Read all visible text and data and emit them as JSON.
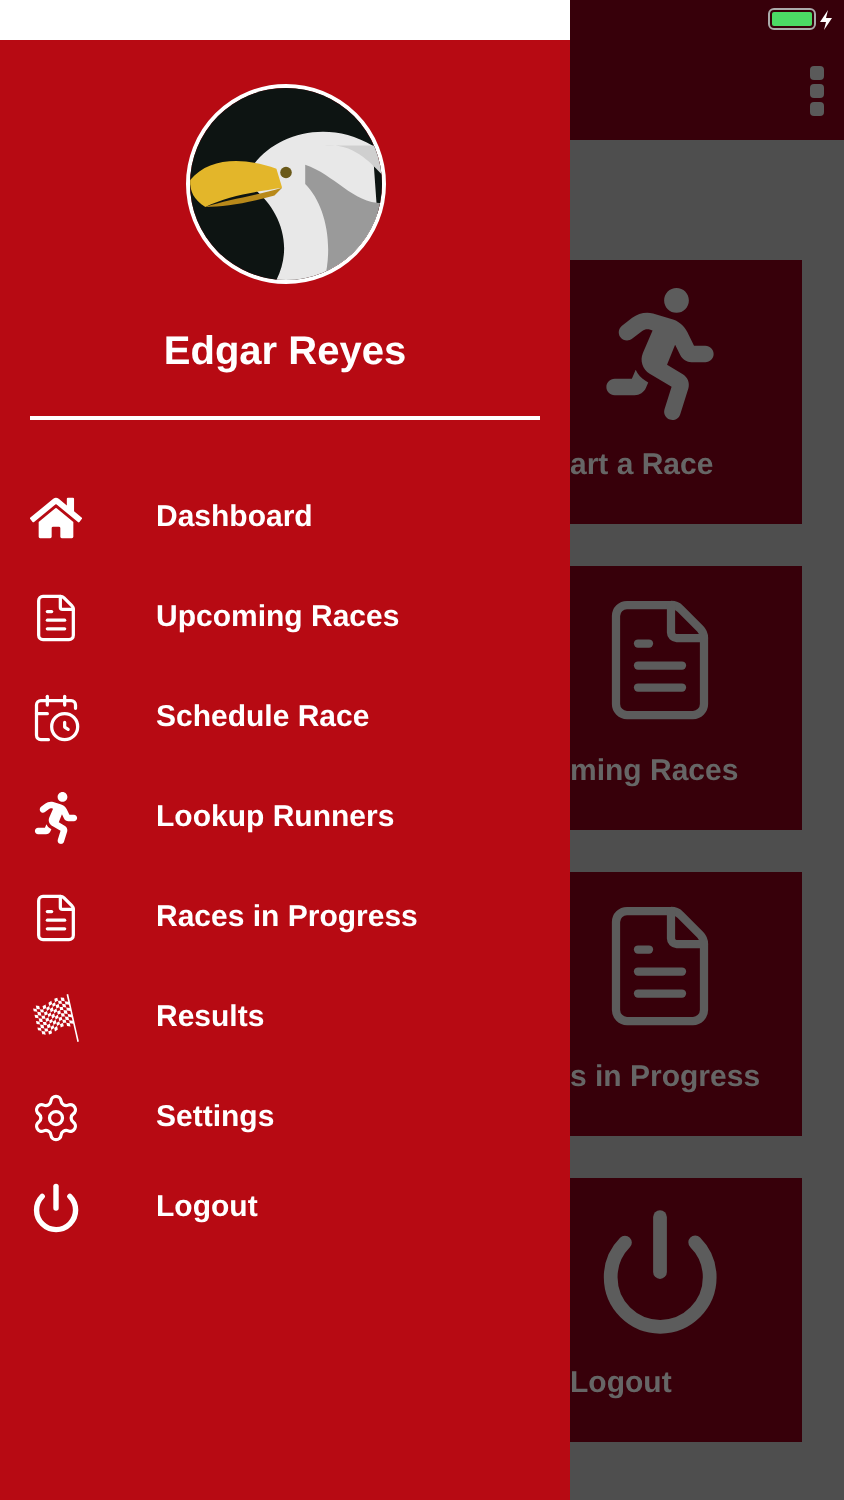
{
  "drawer": {
    "user_name": "Edgar Reyes",
    "menu": [
      {
        "label": "Dashboard",
        "kind": "home"
      },
      {
        "label": "Upcoming Races",
        "kind": "document"
      },
      {
        "label": "Schedule Race",
        "kind": "calendar"
      },
      {
        "label": "Lookup Runners",
        "kind": "runner"
      },
      {
        "label": "Races in Progress",
        "kind": "document"
      },
      {
        "label": "Results",
        "kind": "flag"
      },
      {
        "label": "Settings",
        "kind": "gear"
      },
      {
        "label": "Logout",
        "kind": "power"
      }
    ]
  },
  "tiles": [
    {
      "label": "art a Race",
      "kind": "runner"
    },
    {
      "label": "ming Races",
      "kind": "document"
    },
    {
      "label": "s in Progress",
      "kind": "document"
    },
    {
      "label": "Logout",
      "kind": "power"
    }
  ]
}
